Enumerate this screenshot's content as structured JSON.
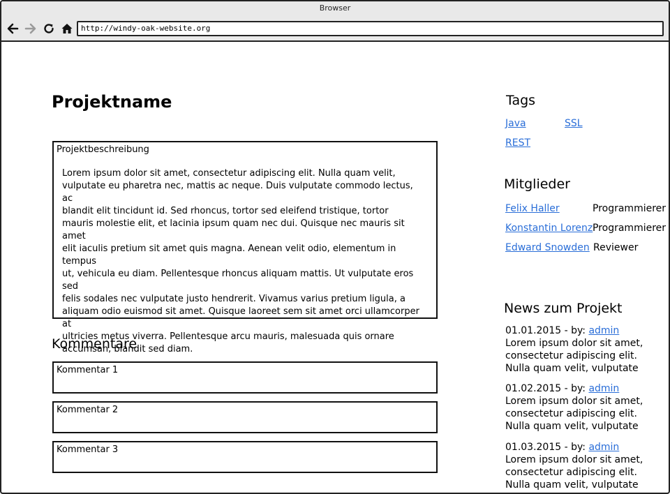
{
  "window": {
    "title": "Browser"
  },
  "browser": {
    "url": "http://windy-oak-website.org"
  },
  "page": {
    "title": "Projektname",
    "description_label": "Projektbeschreibung",
    "description_lines": [
      "Lorem ipsum dolor sit amet, consectetur adipiscing elit. Nulla quam velit,",
      "vulputate eu pharetra nec, mattis ac neque. Duis vulputate commodo lectus, ac",
      "blandit elit tincidunt id. Sed rhoncus, tortor sed eleifend tristique, tortor",
      "mauris molestie elit, et lacinia ipsum quam nec dui. Quisque nec mauris sit amet",
      "elit iaculis pretium sit amet quis magna. Aenean velit odio, elementum in tempus",
      "ut, vehicula eu diam. Pellentesque rhoncus aliquam mattis. Ut vulputate eros sed",
      "felis sodales nec vulputate justo hendrerit. Vivamus varius pretium ligula, a",
      "aliquam odio euismod sit amet. Quisque laoreet sem sit amet orci ullamcorper at",
      "ultricies metus viverra. Pellentesque arcu mauris, malesuada quis ornare",
      "accumsan, blandit sed diam."
    ],
    "comments_heading": "Kommentare",
    "comments": [
      "Kommentar 1",
      "Kommentar 2",
      "Kommentar 3"
    ]
  },
  "sidebar": {
    "tags_heading": "Tags",
    "tags": [
      "Java",
      "SSL",
      "REST"
    ],
    "members_heading": "Mitglieder",
    "members": [
      {
        "name": "Felix Haller",
        "role": "Programmierer"
      },
      {
        "name": "Konstantin Lorenz",
        "role": "Programmierer"
      },
      {
        "name": "Edward Snowden",
        "role": "Reviewer"
      }
    ],
    "news_heading": "News zum Projekt",
    "news": [
      {
        "date": "01.01.2015 - by:",
        "author": "admin",
        "lines": [
          "Lorem ipsum dolor sit amet,",
          "consectetur adipiscing elit.",
          "Nulla quam velit, vulputate"
        ]
      },
      {
        "date": "01.02.2015 - by:",
        "author": "admin",
        "lines": [
          "Lorem ipsum dolor sit amet,",
          "consectetur adipiscing elit.",
          "Nulla quam velit, vulputate"
        ]
      },
      {
        "date": "01.03.2015 - by:",
        "author": "admin",
        "lines": [
          "Lorem ipsum dolor sit amet,",
          "consectetur adipiscing elit.",
          "Nulla quam velit, vulputate"
        ]
      }
    ]
  },
  "icons": {
    "back": "arrow-left-icon",
    "forward": "arrow-right-icon",
    "reload": "reload-icon",
    "home": "home-icon"
  },
  "colors": {
    "link": "#2a6ed8",
    "chrome": "#e9e9e9"
  }
}
